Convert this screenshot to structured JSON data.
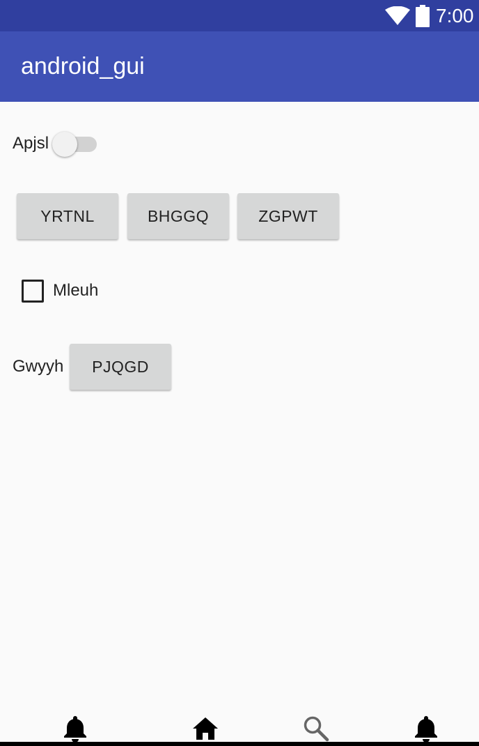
{
  "status_bar": {
    "time": "7:00",
    "icons": [
      "wifi-icon",
      "battery-icon"
    ],
    "color": "#303f9f"
  },
  "app_bar": {
    "title": "android_gui",
    "color": "#3f51b5"
  },
  "switch": {
    "label": "Apjsl",
    "checked": false
  },
  "buttons_row": [
    "YRTNL",
    "BHGGQ",
    "ZGPWT"
  ],
  "checkbox": {
    "label": "Mleuh",
    "checked": false
  },
  "gwyyh_row": {
    "label": "Gwyyh",
    "button": "PJQGD"
  },
  "bottom_nav": {
    "items": [
      "bell-icon",
      "home-icon",
      "search-icon",
      "bell-icon"
    ]
  }
}
